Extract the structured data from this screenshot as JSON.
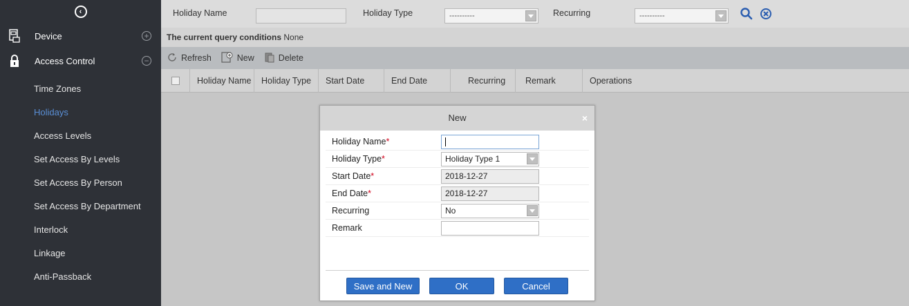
{
  "sidebar": {
    "groups": [
      {
        "label": "Device",
        "state": "+"
      },
      {
        "label": "Access Control",
        "state": "−"
      }
    ],
    "items": [
      {
        "label": "Time Zones"
      },
      {
        "label": "Holidays"
      },
      {
        "label": "Access Levels"
      },
      {
        "label": "Set Access By Levels"
      },
      {
        "label": "Set Access By Person"
      },
      {
        "label": "Set Access By Department"
      },
      {
        "label": "Interlock"
      },
      {
        "label": "Linkage"
      },
      {
        "label": "Anti-Passback"
      }
    ]
  },
  "filter": {
    "holiday_name_label": "Holiday Name",
    "holiday_name_value": "",
    "holiday_type_label": "Holiday Type",
    "holiday_type_value": "----------",
    "recurring_label": "Recurring",
    "recurring_value": "----------"
  },
  "query": {
    "label": "The current query conditions",
    "value": "None"
  },
  "toolbar": {
    "refresh": "Refresh",
    "new": "New",
    "delete": "Delete"
  },
  "table": {
    "columns": [
      "Holiday Name",
      "Holiday Type",
      "Start Date",
      "End Date",
      "Recurring",
      "Remark",
      "Operations"
    ]
  },
  "dialog": {
    "title": "New",
    "close": "×",
    "fields": {
      "holiday_name": {
        "label": "Holiday Name",
        "value": ""
      },
      "holiday_type": {
        "label": "Holiday Type",
        "value": "Holiday Type 1"
      },
      "start_date": {
        "label": "Start Date",
        "value": "2018-12-27"
      },
      "end_date": {
        "label": "End Date",
        "value": "2018-12-27"
      },
      "recurring": {
        "label": "Recurring",
        "value": "No"
      },
      "remark": {
        "label": "Remark",
        "value": ""
      }
    },
    "required_mark": "*",
    "buttons": {
      "save_and_new": "Save and New",
      "ok": "OK",
      "cancel": "Cancel"
    }
  },
  "colors": {
    "sidebar_bg": "#2e3137",
    "active_item": "#5a8fd6",
    "primary_button": "#2f6fc6",
    "icon_blue": "#2a5db0"
  }
}
